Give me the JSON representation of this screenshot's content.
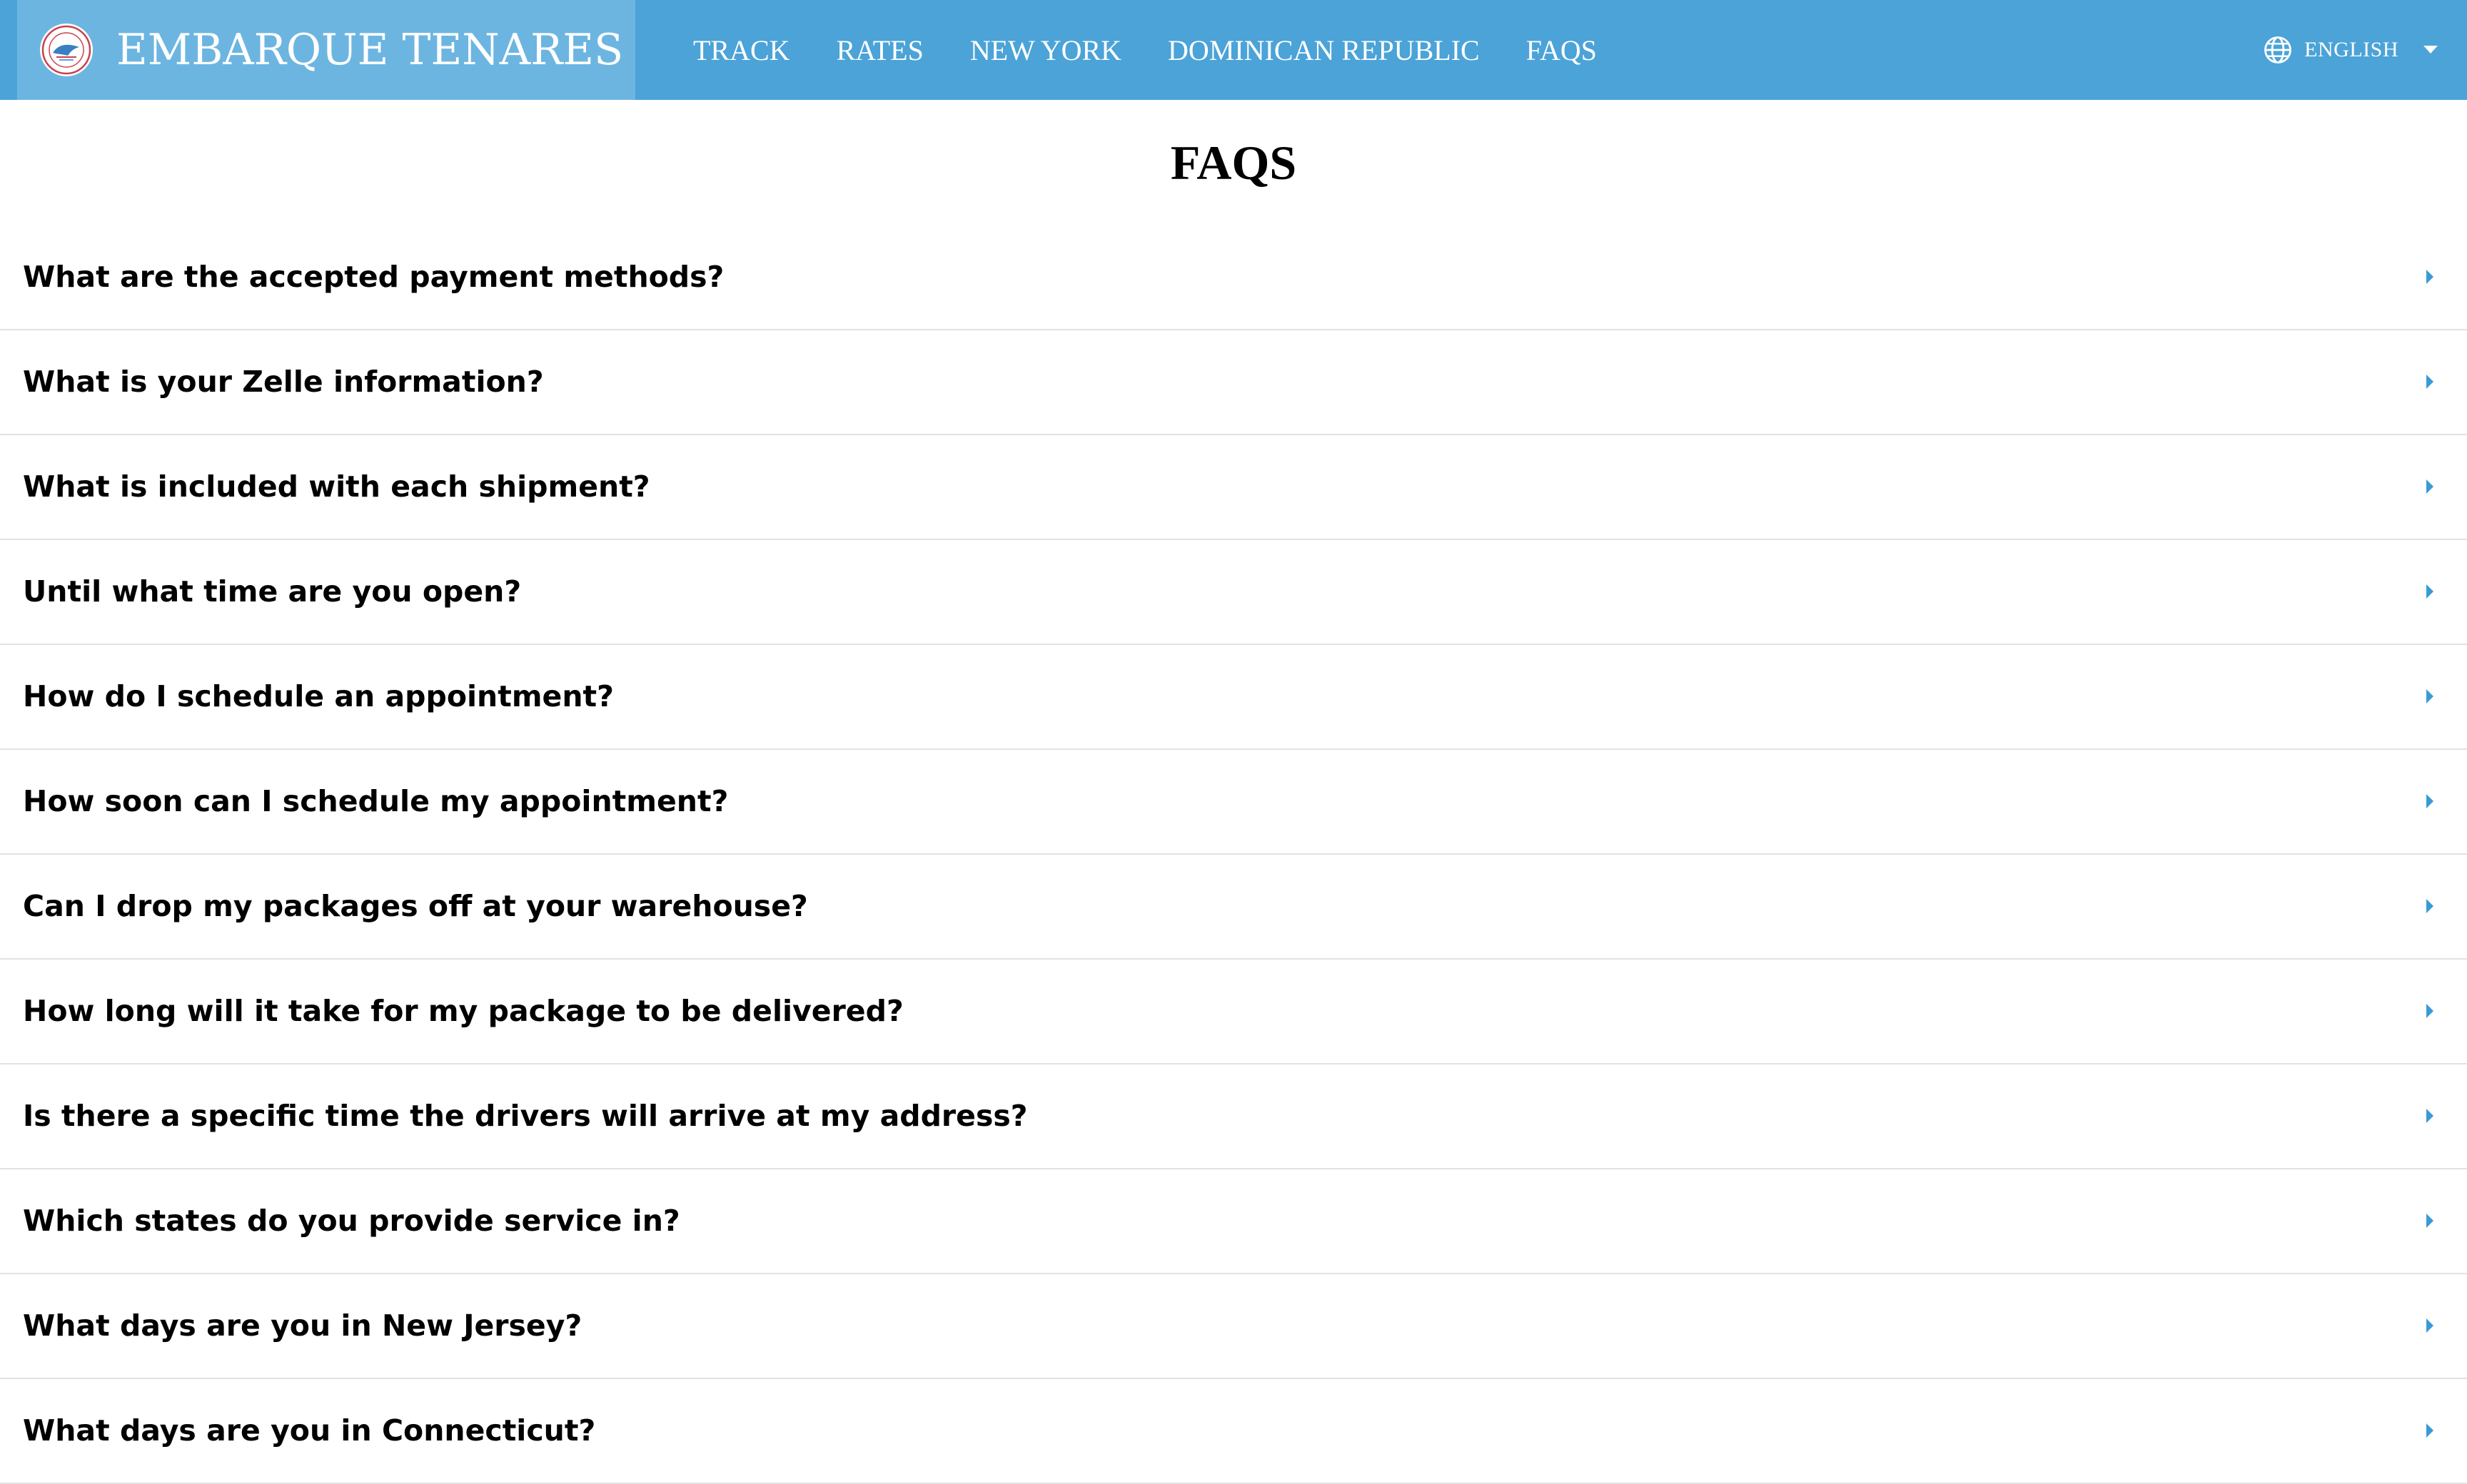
{
  "brand": {
    "name": "EMBARQUE TENARES",
    "logo_icon": "embarque-tenares-seal-logo"
  },
  "nav": {
    "links": [
      {
        "label": "TRACK"
      },
      {
        "label": "RATES"
      },
      {
        "label": "NEW YORK"
      },
      {
        "label": "DOMINICAN REPUBLIC"
      },
      {
        "label": "FAQS"
      }
    ]
  },
  "language": {
    "label": "ENGLISH",
    "icon": "globe-icon"
  },
  "page": {
    "title": "FAQS"
  },
  "faqs": [
    {
      "question": "What are the accepted payment methods?"
    },
    {
      "question": "What is your Zelle information?"
    },
    {
      "question": "What is included with each shipment?"
    },
    {
      "question": "Until what time are you open?"
    },
    {
      "question": "How do I schedule an appointment?"
    },
    {
      "question": "How soon can I schedule my appointment?"
    },
    {
      "question": "Can I drop my packages off at your warehouse?"
    },
    {
      "question": "How long will it take for my package to be delivered?"
    },
    {
      "question": "Is there a specific time the drivers will arrive at my address?"
    },
    {
      "question": "Which states do you provide service in?"
    },
    {
      "question": "What days are you in New Jersey?"
    },
    {
      "question": "What days are you in Connecticut?"
    }
  ],
  "colors": {
    "navbar": "#4ba3d8",
    "brand_block": "#6db5e1",
    "accent_arrow": "#3a9ad6",
    "divider": "#e2e2e2"
  }
}
